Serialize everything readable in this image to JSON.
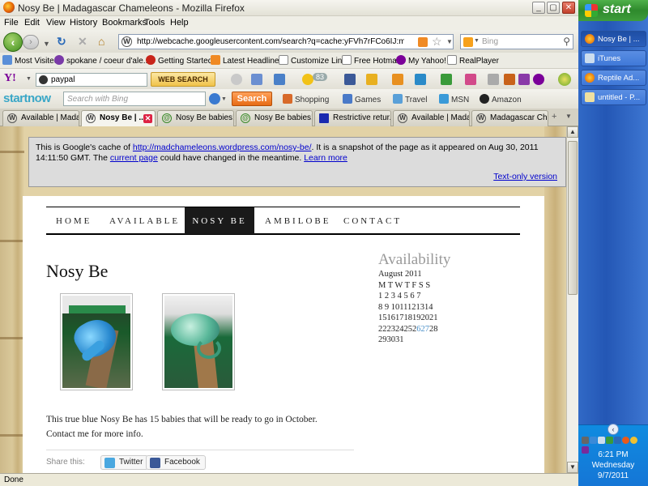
{
  "window": {
    "title": "Nosy Be | Madagascar Chameleons - Mozilla Firefox"
  },
  "menu": [
    "File",
    "Edit",
    "View",
    "History",
    "Bookmarks",
    "Tools",
    "Help"
  ],
  "address": {
    "url": "http://webcache.googleusercontent.com/search?q=cache:yFVh7rFCo6IJ:madchameleons.’",
    "search_placeholder": "Bing"
  },
  "bookmarks": [
    "Most Visited",
    "spokane / coeur d'ale...",
    "Getting Started",
    "Latest Headlines",
    "Customize Links",
    "Free Hotmail",
    "My Yahoo!",
    "RealPlayer"
  ],
  "yahoo_toolbar": {
    "logo": "Y!",
    "query": "paypal",
    "web_search_label": "WEB SEARCH",
    "badge": "83"
  },
  "startnow_toolbar": {
    "logo": "startnow",
    "search_placeholder": "Search with Bing",
    "search_button": "Search",
    "links": [
      "Shopping",
      "Games",
      "Travel",
      "MSN",
      "Amazon"
    ]
  },
  "tabs": [
    {
      "label": "Available | Mada..."
    },
    {
      "label": "Nosy Be | ..."
    },
    {
      "label": "Nosy Be babies!!..."
    },
    {
      "label": "Nosy Be babies!!..."
    },
    {
      "label": "Restrictive retur..."
    },
    {
      "label": "Available | Mada..."
    },
    {
      "label": "Madagascar Cha..."
    }
  ],
  "cache_notice": {
    "prefix": "This is Google's cache of ",
    "link_url": "http://madchameleons.wordpress.com/nosy-be/",
    "middle": ". It is a snapshot of the page as it appeared on Aug 30, 2011 14:11:50 GMT. The ",
    "current_page": "current page",
    "suffix": " could have changed in the meantime. ",
    "learn_more": "Learn more",
    "text_only": "Text-only version"
  },
  "site_nav": [
    "HOME",
    "AVAILABLE",
    "NOSY BE",
    "AMBILOBE",
    "CONTACT"
  ],
  "page": {
    "title": "Nosy Be",
    "description_line1": "This true blue Nosy Be has 15 babies that will be ready to go in October.",
    "description_line2": "Contact me for more info.",
    "share_label": "Share this:",
    "share_buttons": [
      "Twitter",
      "Facebook"
    ]
  },
  "sidebar": {
    "heading": "Availability",
    "month": "August 2011",
    "weekdays": "M T W T F S S",
    "rows": [
      "1 2 3 4 5 6 7",
      "8 9 1011121314",
      "15161718192021",
      "22232425262728",
      "293031"
    ],
    "highlight_day": "27"
  },
  "status": {
    "text": "Done"
  },
  "taskbar": {
    "start_label": "start",
    "items": [
      "Nosy Be | ...",
      "iTunes",
      "Reptile Ad...",
      "untitled - P..."
    ],
    "time": "6:21 PM",
    "weekday": "Wednesday",
    "date": "9/7/2011"
  },
  "colors": {
    "accent_green": "#3f8e1b",
    "nav_active": "#1a1a1a",
    "link_blue": "#0000cc",
    "xp_blue": "#2457b5"
  }
}
